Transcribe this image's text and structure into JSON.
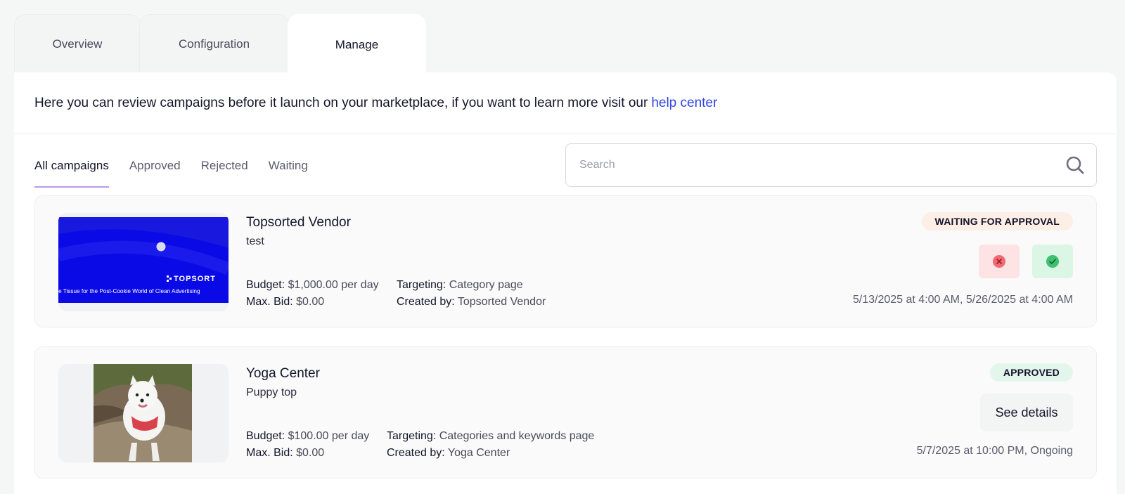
{
  "tabs": [
    {
      "label": "Overview"
    },
    {
      "label": "Configuration"
    },
    {
      "label": "Manage"
    }
  ],
  "intro": {
    "text": "Here you can review campaigns before it launch on your marketplace, if you want to learn more visit our",
    "link": "help center"
  },
  "filters": [
    "All campaigns",
    "Approved",
    "Rejected",
    "Waiting"
  ],
  "search": {
    "placeholder": "Search",
    "value": ""
  },
  "labels": {
    "budget": "Budget:",
    "max_bid": "Max. Bid:",
    "targeting": "Targeting:",
    "created_by": "Created by:"
  },
  "campaigns": [
    {
      "vendor": "Topsorted Vendor",
      "name": "test",
      "budget": "$1,000.00 per day",
      "max_bid": "$0.00",
      "targeting": "Category page",
      "created_by": "Topsorted Vendor",
      "status": "WAITING FOR APPROVAL",
      "dates": "5/13/2025 at 4:00 AM, 5/26/2025 at 4:00 AM",
      "banner_brand": "TOPSORT",
      "banner_text": "ve Tissue for the Post-Cookie World of Clean Advertising"
    },
    {
      "vendor": "Yoga Center",
      "name": "Puppy top",
      "budget": "$100.00 per day",
      "max_bid": "$0.00",
      "targeting": "Categories and keywords page",
      "created_by": "Yoga Center",
      "status": "APPROVED",
      "dates": "5/7/2025 at 10:00 PM, Ongoing",
      "action": "See details"
    }
  ],
  "colors": {
    "accent": "#b999e6",
    "link": "#3044e6",
    "banner": "#0a0ae6",
    "reject": "#f06a72",
    "approve": "#3fbf6f"
  }
}
